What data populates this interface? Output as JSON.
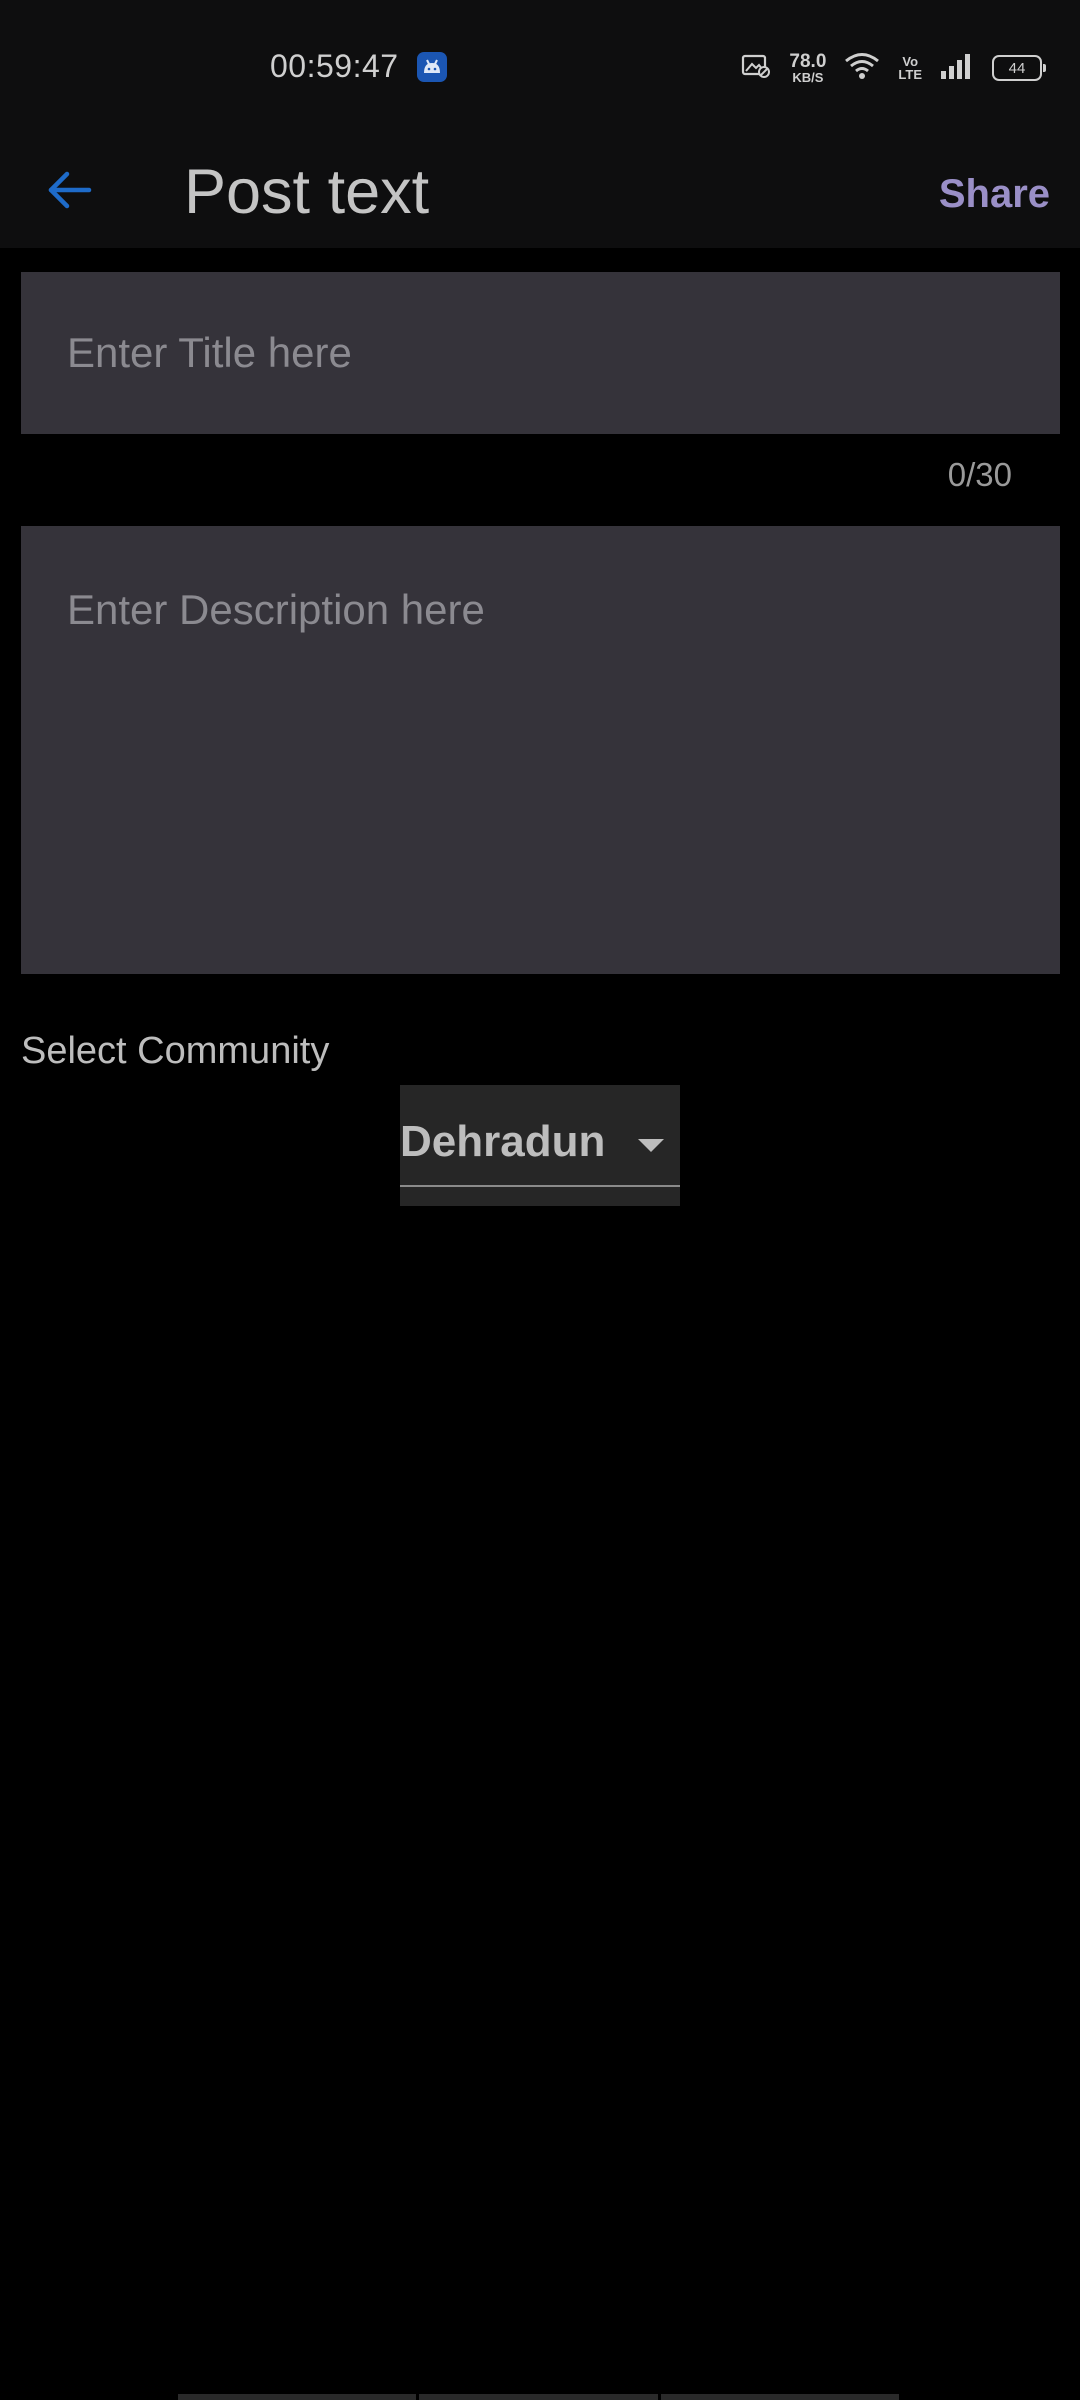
{
  "status_bar": {
    "time": "00:59:47",
    "net_speed_value": "78.0",
    "net_speed_unit": "KB/S",
    "volte_top": "Vo",
    "volte_bottom": "LTE",
    "battery": "44"
  },
  "app_bar": {
    "title": "Post text",
    "share_label": "Share",
    "back_icon": "arrow-left-icon"
  },
  "form": {
    "title_placeholder": "Enter Title here",
    "title_counter": "0/30",
    "description_placeholder": "Enter Description here",
    "community_label": "Select Community",
    "community_selected": "Dehradun"
  },
  "colors": {
    "accent_back": "#1e6bc9",
    "accent_share": "#9a8fc7",
    "field_bg": "#35333a",
    "page_bg": "#000000"
  }
}
